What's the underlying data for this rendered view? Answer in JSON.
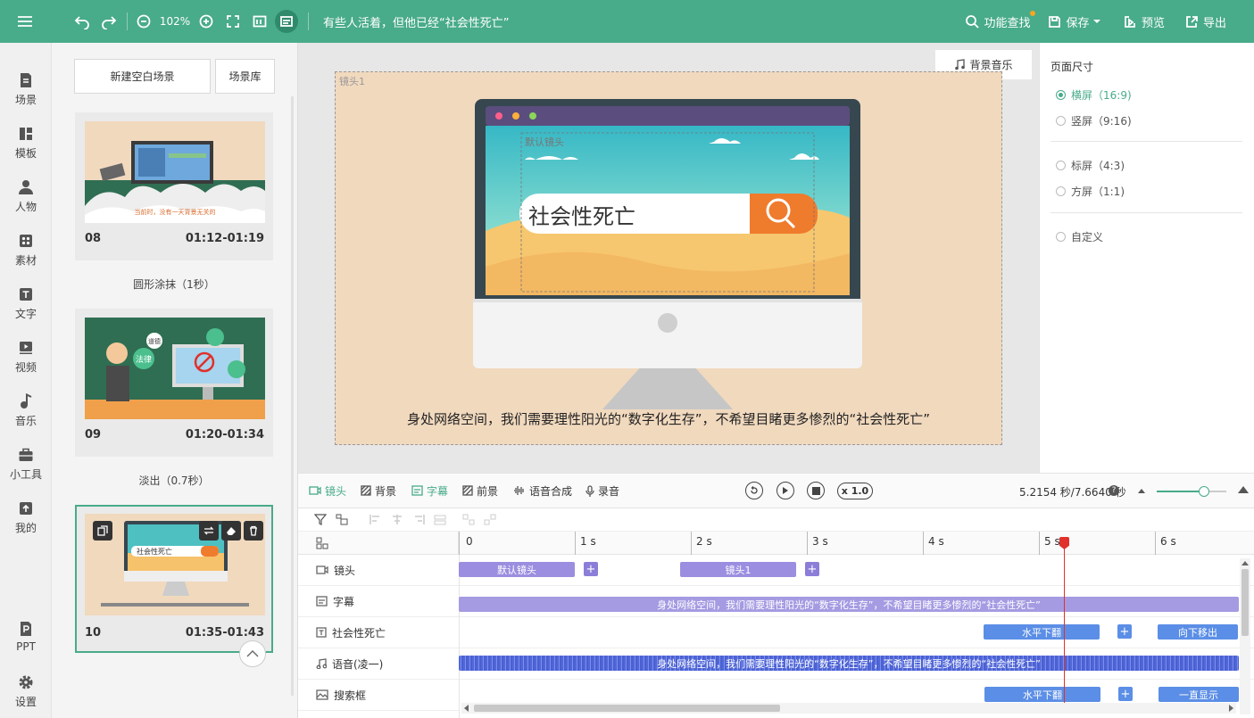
{
  "toolbar": {
    "zoom": "102%",
    "project_title": "有些人活着，但他已经“社会性死亡”",
    "feature_search": "功能查找",
    "save": "保存",
    "preview": "预览",
    "export": "导出"
  },
  "nav": [
    {
      "label": "场景"
    },
    {
      "label": "模板"
    },
    {
      "label": "人物"
    },
    {
      "label": "素材"
    },
    {
      "label": "文字"
    },
    {
      "label": "视频"
    },
    {
      "label": "音乐"
    },
    {
      "label": "小工具"
    },
    {
      "label": "我的"
    },
    {
      "label": "PPT"
    },
    {
      "label": "设置"
    }
  ],
  "scenes": {
    "new_blank": "新建空白场景",
    "library": "场景库",
    "cards": [
      {
        "num": "08",
        "time": "01:12-01:19",
        "transition": "圆形涂抹（1秒）",
        "caption": "当前时，没有一天背景无关的"
      },
      {
        "num": "09",
        "time": "01:20-01:34",
        "transition": "淡出（0.7秒）",
        "bubble1": "法律",
        "bubble2": "道德"
      },
      {
        "num": "10",
        "time": "01:35-01:43",
        "search": "社会性死亡"
      }
    ]
  },
  "canvas": {
    "bg_music": "背景音乐",
    "shot_label": "镜头1",
    "default_shot": "默认镜头",
    "search_text": "社会性死亡",
    "subtitle": "身处网络空间，我们需要理性阳光的“数字化生存”，不希望目睹更多惨烈的“社会性死亡”"
  },
  "page_size": {
    "title": "页面尺寸",
    "options": [
      {
        "label": "横屏（16:9)",
        "selected": true
      },
      {
        "label": "竖屏（9:16)",
        "selected": false
      },
      {
        "label": "标屏（4:3)",
        "selected": false
      },
      {
        "label": "方屏（1:1)",
        "selected": false
      },
      {
        "label": "自定义",
        "selected": false
      }
    ]
  },
  "timeline": {
    "tabs": [
      "镜头",
      "背景",
      "字幕",
      "前景",
      "语音合成",
      "录音"
    ],
    "speed": "x 1.0",
    "time_readout": "5.2154 秒/7.6640 秒",
    "ruler": [
      "0",
      "1 s",
      "2 s",
      "3 s",
      "4 s",
      "5 s",
      "6 s"
    ],
    "tracks": [
      {
        "label": "镜头"
      },
      {
        "label": "字幕"
      },
      {
        "label": "社会性死亡"
      },
      {
        "label": "语音(凌一)"
      },
      {
        "label": "搜索框"
      }
    ],
    "clips": {
      "shot_default": "默认镜头",
      "shot_1": "镜头1",
      "subtitle": "身处网络空间，我们需要理性阳光的“数字化生存”，不希望目睹更多惨烈的“社会性死亡”",
      "text_in": "水平下翻",
      "text_out": "向下移出",
      "voice": "身处网络空间，我们需要理性阳光的“数字化生存”，不希望目睹更多惨烈的“社会性死亡”",
      "search_in": "水平下翻",
      "search_loop": "一直显示"
    },
    "playhead_seconds": 5.2154
  }
}
